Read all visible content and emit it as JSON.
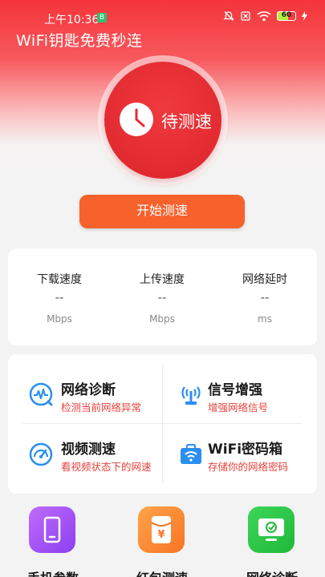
{
  "status_bar": {
    "time": "上午10:36",
    "badge": "B",
    "battery": "60"
  },
  "header": {
    "title": "WiFi钥匙免费秒连"
  },
  "gauge": {
    "label": "待测速"
  },
  "start_button": {
    "label": "开始测速"
  },
  "speed": [
    {
      "label": "下载速度",
      "value": "--",
      "unit": "Mbps"
    },
    {
      "label": "上传速度",
      "value": "--",
      "unit": "Mbps"
    },
    {
      "label": "网络延时",
      "value": "--",
      "unit": "ms"
    }
  ],
  "tools": [
    {
      "title": "网络诊断",
      "subtitle": "检测当前网络异常",
      "icon": "pulse-icon"
    },
    {
      "title": "信号增强",
      "subtitle": "增强网络信号",
      "icon": "antenna-icon"
    },
    {
      "title": "视频测速",
      "subtitle": "看视频状态下的网速",
      "icon": "speedometer-icon"
    },
    {
      "title": "WiFi密码箱",
      "subtitle": "存储你的网络密码",
      "icon": "wifi-box-icon"
    }
  ],
  "bottom_nav": [
    {
      "label": "手机参数",
      "icon": "phone-icon",
      "color": "#a855f7"
    },
    {
      "label": "红包测速",
      "icon": "red-packet-icon",
      "color": "#fb8a2c"
    },
    {
      "label": "网络诊断",
      "icon": "monitor-icon",
      "color": "#2ecc40"
    }
  ],
  "colors": {
    "accent_red": "#e42d33",
    "button_orange": "#f6612c",
    "subtitle_red": "#e8413c",
    "icon_blue": "#2b8ff0"
  }
}
